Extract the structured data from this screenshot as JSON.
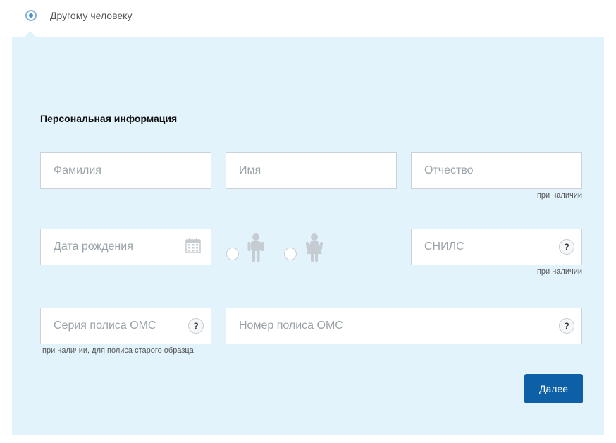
{
  "recipient_option": {
    "label": "Другому человеку",
    "selected": true
  },
  "section": {
    "title": "Персональная информация"
  },
  "fields": {
    "last_name": {
      "placeholder": "Фамилия"
    },
    "first_name": {
      "placeholder": "Имя"
    },
    "patronymic": {
      "placeholder": "Отчество",
      "hint": "при наличии"
    },
    "birth_date": {
      "placeholder": "Дата рождения"
    },
    "snils": {
      "placeholder": "СНИЛС",
      "hint": "при наличии"
    },
    "oms_series": {
      "placeholder": "Серия полиса ОМС",
      "hint": "при наличии, для полиса старого образца"
    },
    "oms_number": {
      "placeholder": "Номер полиса ОМС"
    }
  },
  "help_icon_text": "?",
  "gender": {
    "options": [
      "male-icon",
      "female-icon"
    ]
  },
  "next_button": {
    "label": "Далее"
  },
  "colors": {
    "panel_bg": "#e2f3fc",
    "primary_button": "#0d5fa6",
    "radio_accent": "#4a90c8",
    "placeholder_text": "#9aa3a8"
  }
}
